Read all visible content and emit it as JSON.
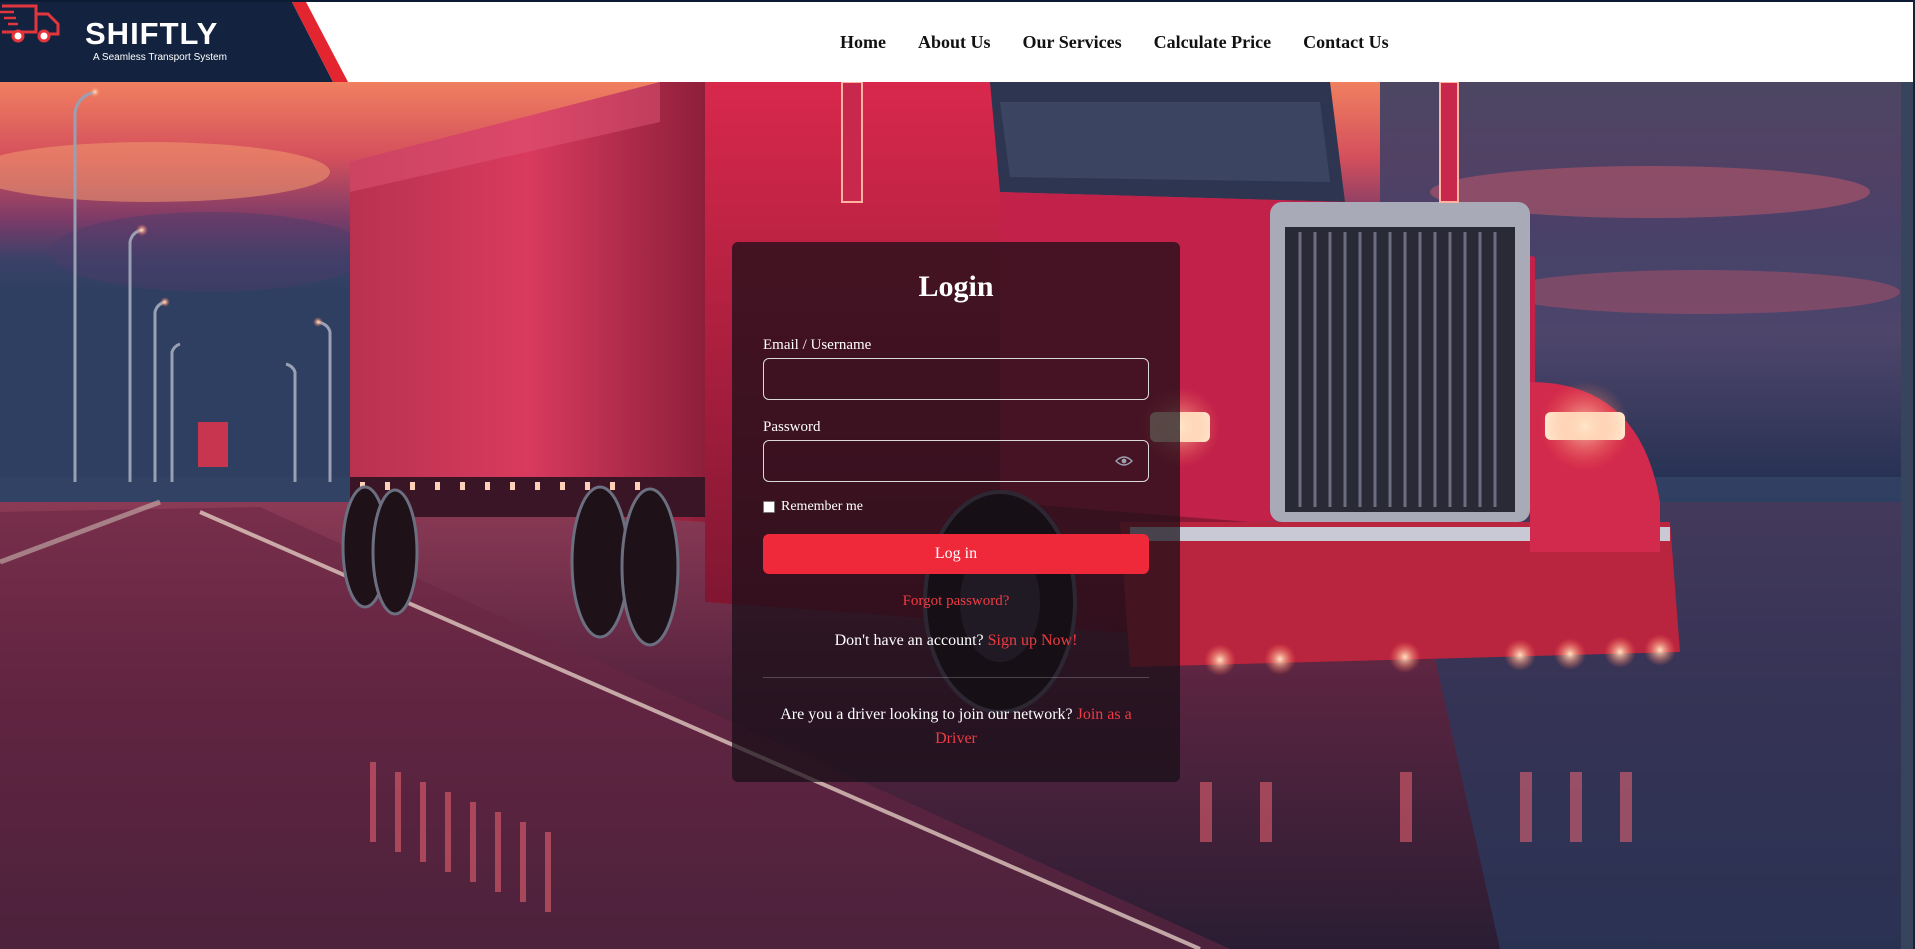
{
  "brand": {
    "name": "SHIFTLY",
    "tagline": "A Seamless Transport System"
  },
  "nav": {
    "items": [
      {
        "label": "Home"
      },
      {
        "label": "About Us"
      },
      {
        "label": "Our Services"
      },
      {
        "label": "Calculate Price"
      },
      {
        "label": "Contact Us"
      }
    ]
  },
  "login": {
    "title": "Login",
    "email_label": "Email / Username",
    "email_value": "",
    "password_label": "Password",
    "password_value": "",
    "remember_label": "Remember me",
    "remember_checked": false,
    "submit_label": "Log in",
    "forgot_label": "Forgot password?",
    "signup_prompt": "Don't have an account?",
    "signup_link": "Sign up Now!",
    "driver_prompt": "Are you a driver looking to join our network?",
    "driver_link": "Join as a Driver"
  },
  "colors": {
    "accent": "#f0293a",
    "link": "#ef3b43",
    "brand_navy": "#13233f"
  },
  "icons": {
    "logo_truck": "truck-icon",
    "password_toggle": "eye-icon"
  }
}
